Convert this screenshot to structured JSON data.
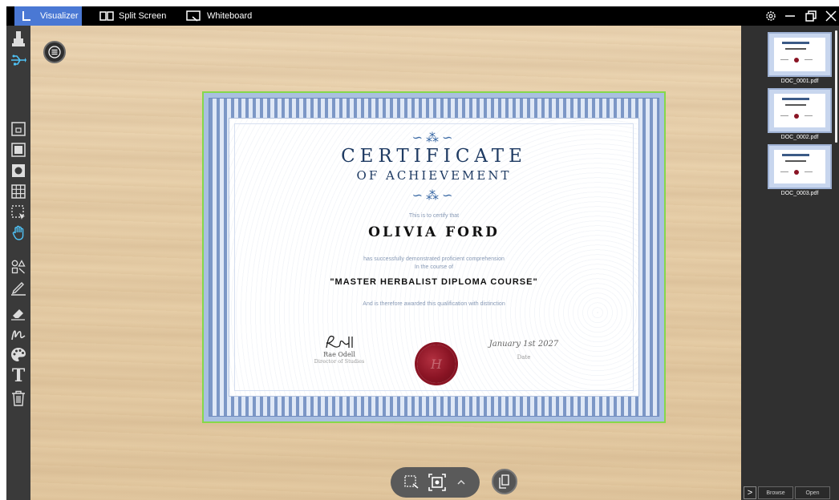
{
  "tabs": [
    {
      "label": "Visualizer",
      "icon": "visualizer-icon",
      "active": true
    },
    {
      "label": "Split Screen",
      "icon": "split-screen-icon",
      "active": false
    },
    {
      "label": "Whiteboard",
      "icon": "whiteboard-icon",
      "active": false
    }
  ],
  "window_controls": [
    "settings-icon",
    "minimize-icon",
    "restore-icon",
    "close-icon"
  ],
  "toolbar": {
    "tools": [
      "camera-icon",
      "usb-icon",
      "frame-small-icon",
      "frame-full-icon",
      "spotlight-icon",
      "grid-icon",
      "select-icon",
      "hand-icon",
      "shapes-icon",
      "pen-icon",
      "eraser-icon",
      "freehand-icon",
      "palette-icon",
      "text-icon",
      "trash-icon"
    ]
  },
  "certificate": {
    "title": "CERTIFICATE",
    "subtitle": "OF ACHIEVEMENT",
    "certify_text": "This is to certify that",
    "recipient": "OLIVIA FORD",
    "line1": "has successfully demonstrated proficient comprehension",
    "line2": "In the course of",
    "course": "\"MASTER HERBALIST DIPLOMA COURSE\"",
    "awarded": "And is therefore awarded this qualification with distinction",
    "signer_name": "Rae Odell",
    "signer_role": "Director of Studies",
    "date_value": "January 1st 2027",
    "date_label": "Date"
  },
  "documents": [
    {
      "label": "DOC_0001.pdf"
    },
    {
      "label": "DOC_0002.pdf"
    },
    {
      "label": "DOC_0003.pdf"
    }
  ],
  "panel_buttons": {
    "expand": ">",
    "browse": "Browse",
    "open": "Open"
  },
  "colors": {
    "active_tab": "#4a78d4",
    "accent_green": "#86d84a",
    "tool_active": "#4fc3f7"
  }
}
